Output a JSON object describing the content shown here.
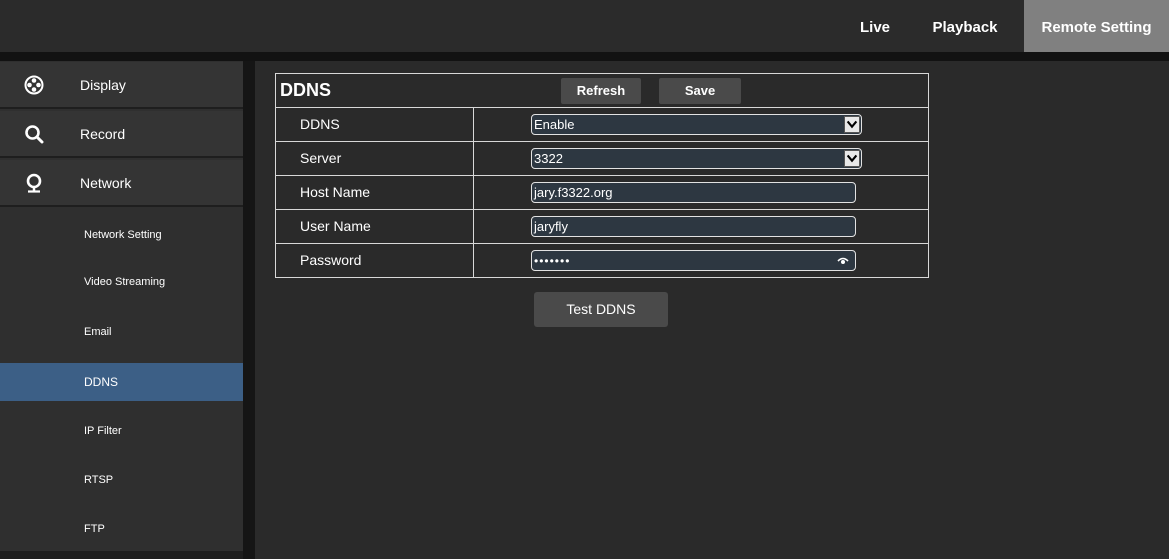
{
  "topnav": {
    "live": "Live",
    "playback": "Playback",
    "remote_setting": "Remote Setting"
  },
  "sidebar": {
    "menu": [
      {
        "label": "Display",
        "icon": "display-icon"
      },
      {
        "label": "Record",
        "icon": "search-icon"
      },
      {
        "label": "Network",
        "icon": "network-icon"
      }
    ],
    "network_items": [
      {
        "label": "Network Setting"
      },
      {
        "label": "Video Streaming"
      },
      {
        "label": "Email"
      },
      {
        "label": "DDNS",
        "active": true
      },
      {
        "label": "IP Filter"
      },
      {
        "label": "RTSP"
      },
      {
        "label": "FTP"
      }
    ]
  },
  "ddns": {
    "title": "DDNS",
    "refresh_label": "Refresh",
    "save_label": "Save",
    "rows": [
      {
        "label": "DDNS",
        "value": "Enable",
        "type": "select"
      },
      {
        "label": "Server",
        "value": "3322",
        "type": "select"
      },
      {
        "label": "Host Name",
        "value": "jary.f3322.org",
        "type": "input"
      },
      {
        "label": "User Name",
        "value": "jaryfly",
        "type": "input"
      },
      {
        "label": "Password",
        "value": "•••••••",
        "type": "password"
      }
    ],
    "test_label": "Test DDNS"
  },
  "colors": {
    "accent_active": "#3c5f86",
    "remote_tab_bg": "#808080",
    "background": "#2a2a2a"
  }
}
